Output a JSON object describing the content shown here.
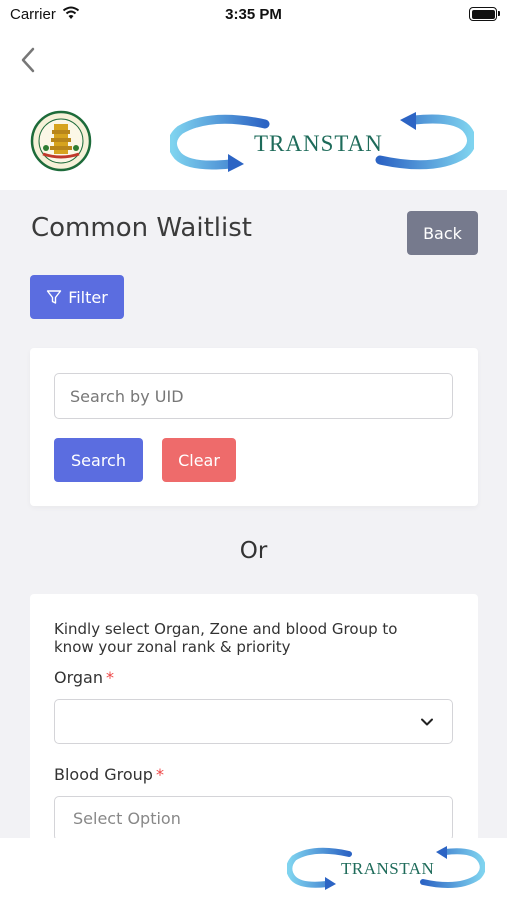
{
  "status_bar": {
    "carrier": "Carrier",
    "time": "3:35 PM",
    "battery_level": 1.0
  },
  "header": {
    "back_icon": "chevron-left-icon",
    "emblem_icon": "tamil-nadu-emblem",
    "logo_text": "TRANSTAN"
  },
  "page": {
    "title": "Common Waitlist",
    "back_label": "Back",
    "filter_label": "Filter",
    "filter_icon": "funnel-icon"
  },
  "search": {
    "uid_placeholder": "Search by UID",
    "uid_value": "",
    "search_label": "Search",
    "clear_label": "Clear"
  },
  "divider": {
    "or_label": "Or"
  },
  "selection": {
    "instruction": "Kindly select Organ, Zone and blood Group to know your zonal rank & priority",
    "organ_label": "Organ",
    "organ_value": "",
    "blood_group_label": "Blood Group",
    "blood_group_placeholder": "Select Option",
    "required_marker": "*"
  },
  "footer": {
    "logo_text": "TRANSTAN"
  },
  "colors": {
    "primary": "#5b6de0",
    "danger": "#ee6b6b",
    "secondary": "#767a8d",
    "required": "#ee4444",
    "logo_green": "#1e6b5a"
  }
}
